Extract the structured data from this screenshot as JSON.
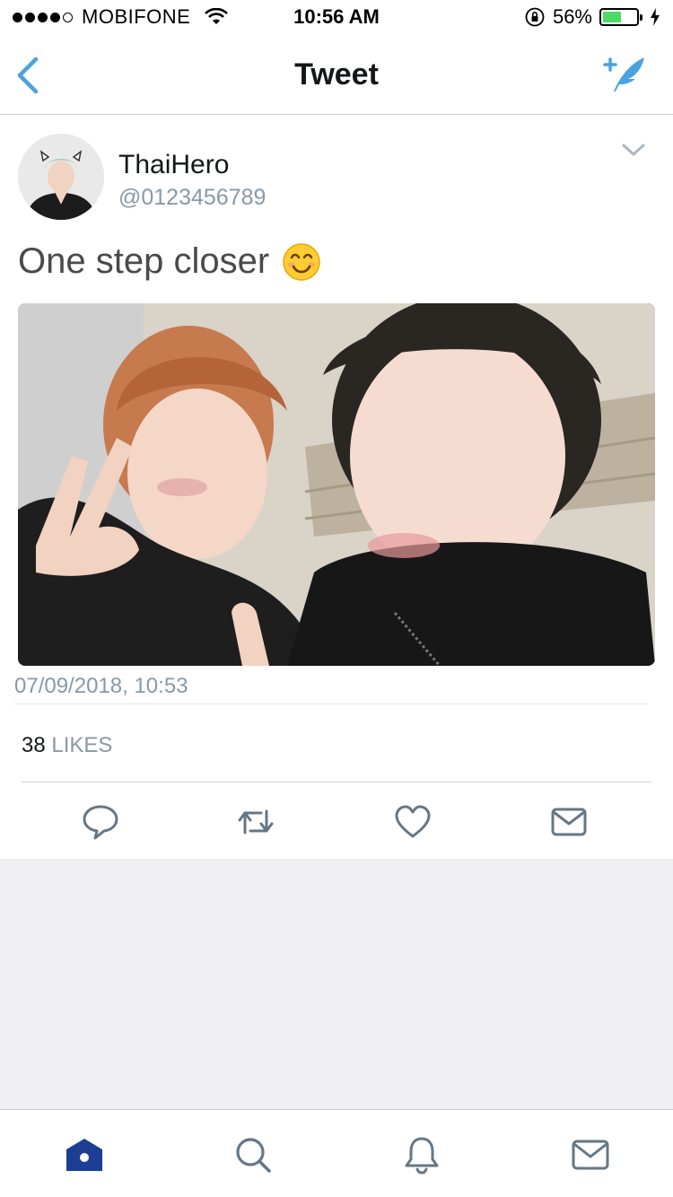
{
  "status_bar": {
    "carrier": "MOBIFONE",
    "time": "10:56 AM",
    "battery_percent_label": "56%",
    "battery_level": 0.56,
    "signal_bars": 4,
    "icons": [
      "signal-dots-icon",
      "wifi-icon",
      "rotation-lock-icon",
      "battery-icon",
      "charging-bolt-icon"
    ]
  },
  "nav": {
    "title": "Tweet",
    "back_icon": "chevron-left-icon",
    "compose_icon": "compose-quill-icon"
  },
  "tweet": {
    "user_name": "ThaiHero",
    "user_handle": "@0123456789",
    "text": "One step closer",
    "emoji": "smiling-face-emoji",
    "timestamp": "07/09/2018, 10:53",
    "likes_count": "38",
    "likes_label": "LIKES",
    "actions": [
      "reply-icon",
      "retweet-icon",
      "like-heart-icon",
      "direct-message-icon"
    ]
  },
  "tab_bar": {
    "tabs": [
      "home-icon",
      "search-icon",
      "notifications-bell-icon",
      "messages-envelope-icon"
    ]
  },
  "colors": {
    "accent": "#1da1f2",
    "nav_icon": "#4aa3df",
    "active_tab": "#1c3f94",
    "secondary_text": "#8899a6",
    "battery": "#4cd964",
    "empty_background": "#efeff4"
  }
}
